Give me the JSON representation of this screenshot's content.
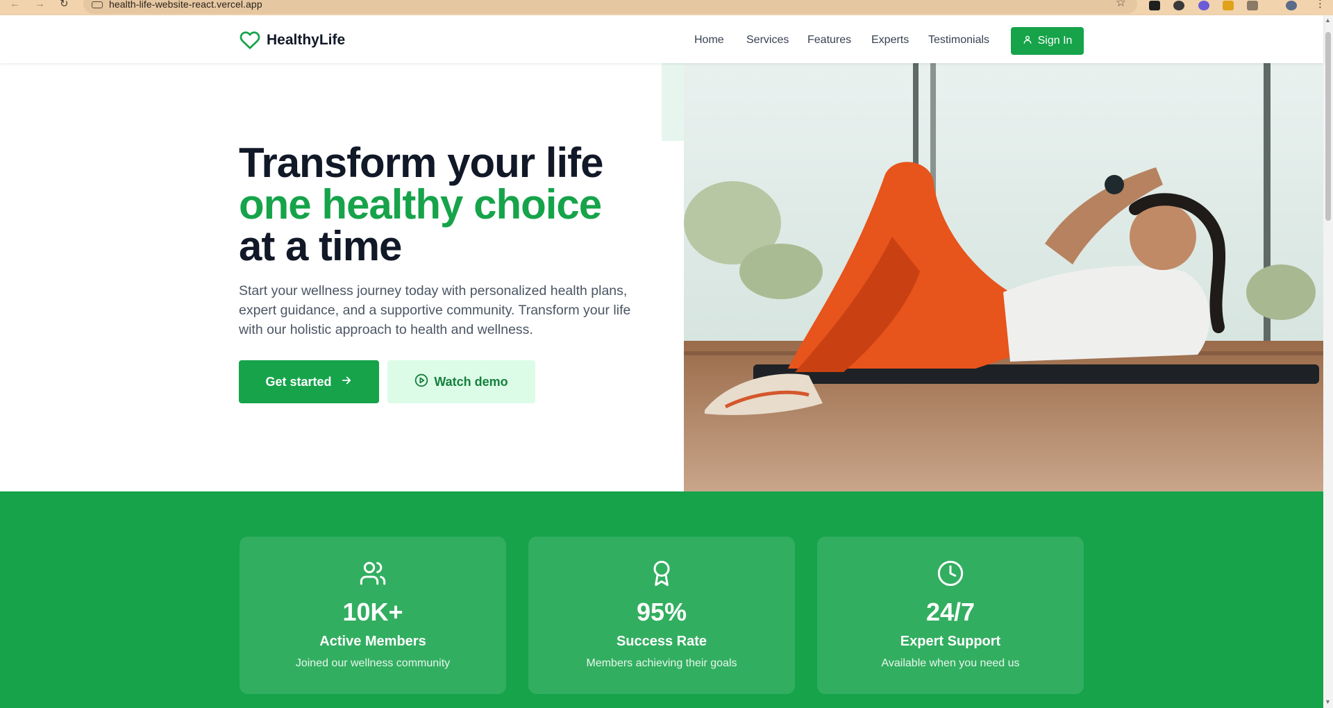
{
  "browser": {
    "url": "health-life-website-react.vercel.app",
    "back_icon": "arrow-left",
    "forward_icon": "arrow-right",
    "reload_icon": "reload",
    "star_icon": "star"
  },
  "header": {
    "brand": "HealthyLife",
    "nav": [
      "Home",
      "Services",
      "Features",
      "Experts",
      "Testimonials"
    ],
    "signin_label": "Sign In"
  },
  "hero": {
    "title_line1": "Transform your life",
    "title_line2": "one healthy choice",
    "title_line3": "at a time",
    "subtitle": "Start your wellness journey today with personalized health plans, expert guidance, and a supportive community. Transform your life with our holistic approach to health and wellness.",
    "primary_cta": "Get started",
    "secondary_cta": "Watch demo"
  },
  "stats": [
    {
      "icon": "users-icon",
      "value": "10K+",
      "label": "Active Members",
      "desc": "Joined our wellness community"
    },
    {
      "icon": "award-icon",
      "value": "95%",
      "label": "Success Rate",
      "desc": "Members achieving their goals"
    },
    {
      "icon": "clock-icon",
      "value": "24/7",
      "label": "Expert Support",
      "desc": "Available when you need us"
    }
  ],
  "colors": {
    "brand_green": "#16a34a",
    "light_green": "#dcfce7",
    "heading": "#111827",
    "body_text": "#4b5563"
  }
}
